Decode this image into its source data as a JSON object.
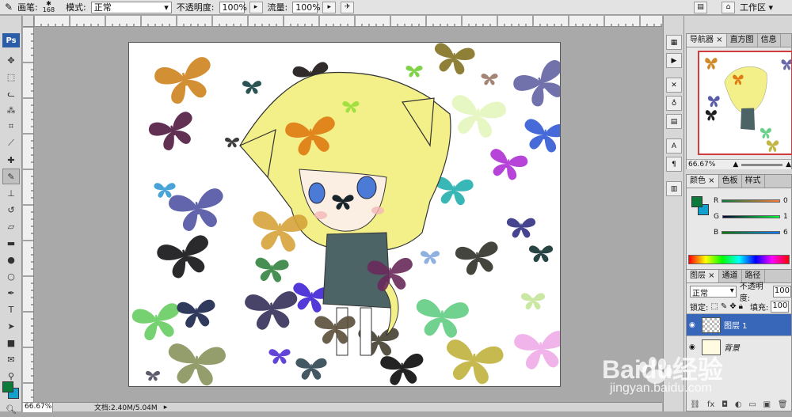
{
  "options_bar": {
    "brush_label": "画笔:",
    "brush_size": "168",
    "mode_label": "模式:",
    "mode_value": "正常",
    "opacity_label": "不透明度:",
    "opacity_value": "100%",
    "flow_label": "流量:",
    "flow_value": "100%",
    "workspace_label": "工作区"
  },
  "toolbox": {
    "logo": "Ps",
    "tools": [
      "move-icon",
      "marquee-icon",
      "lasso-icon",
      "magic-wand-icon",
      "crop-icon",
      "slice-icon",
      "healing-icon",
      "brush-icon",
      "stamp-icon",
      "history-brush-icon",
      "eraser-icon",
      "gradient-icon",
      "blur-icon",
      "dodge-icon",
      "pen-icon",
      "type-icon",
      "path-select-icon",
      "shape-icon",
      "notes-icon",
      "eyedropper-icon",
      "hand-icon",
      "zoom-icon"
    ],
    "foreground_color": "#0b7a3a",
    "background_color": "#14a0cf"
  },
  "status": {
    "zoom": "66.67%",
    "doc": "文档:2.40M/5.04M"
  },
  "navigator": {
    "tabs": [
      "导航器",
      "直方图",
      "信息"
    ],
    "zoom": "66.67%"
  },
  "color_panel": {
    "tabs": [
      "颜色",
      "色板",
      "样式"
    ],
    "channels": [
      {
        "label": "R",
        "value": "0"
      },
      {
        "label": "G",
        "value": "1"
      },
      {
        "label": "B",
        "value": "6"
      }
    ]
  },
  "layers_panel": {
    "tabs": [
      "图层",
      "通道",
      "路径"
    ],
    "blend_mode": "正常",
    "opacity_label": "不透明度:",
    "opacity_value": "100",
    "lock_label": "锁定:",
    "fill_label": "填充:",
    "fill_value": "100",
    "layers": [
      {
        "name": "图层 1",
        "active": true
      },
      {
        "name": "背景",
        "active": false
      }
    ]
  },
  "watermark": {
    "brand": "Baidu经验",
    "url": "jingyan.baidu.com"
  },
  "colors": {
    "accent_blue": "#3866b8",
    "ps_blue": "#2b5da8"
  }
}
